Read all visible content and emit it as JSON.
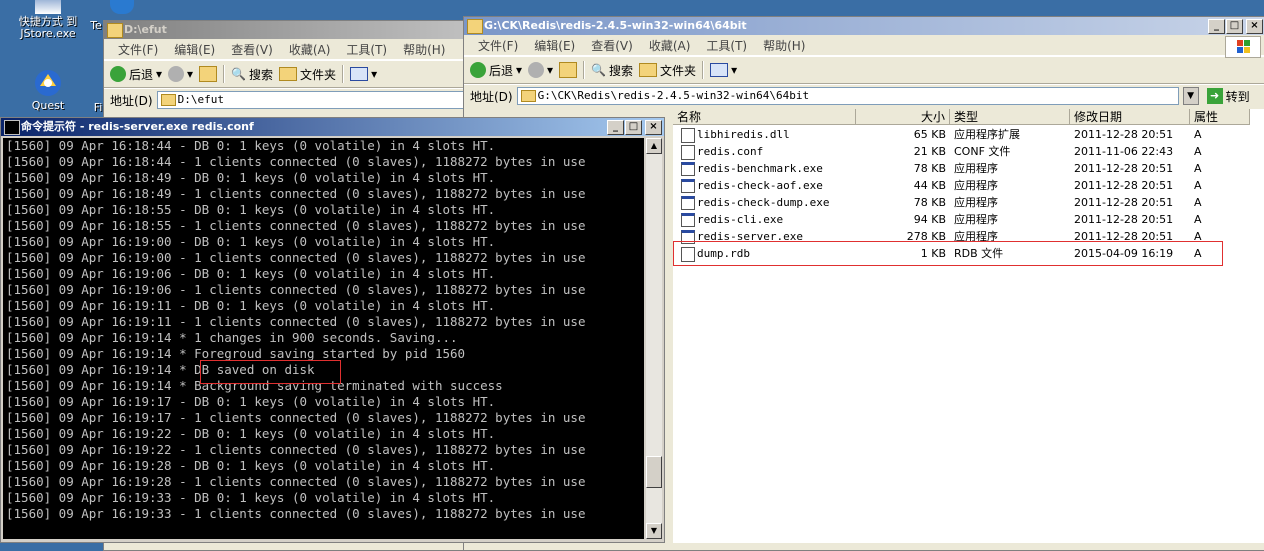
{
  "desktop": {
    "icon1_label": "快捷方式 到",
    "icon1_sublabel": "JStore.exe",
    "icon2_label": "Quest",
    "icon3_label": "Te",
    "icon4_label": "Fi"
  },
  "explorer_back": {
    "title": "D:\\efut",
    "menu": [
      "文件(F)",
      "编辑(E)",
      "查看(V)",
      "收藏(A)",
      "工具(T)",
      "帮助(H)"
    ],
    "back_label": "后退",
    "search_label": "搜索",
    "folders_label": "文件夹",
    "address_label": "地址(D)",
    "address_value": "D:\\efut"
  },
  "explorer_front": {
    "title": "G:\\CK\\Redis\\redis-2.4.5-win32-win64\\64bit",
    "menu": [
      "文件(F)",
      "编辑(E)",
      "查看(V)",
      "收藏(A)",
      "工具(T)",
      "帮助(H)"
    ],
    "back_label": "后退",
    "search_label": "搜索",
    "folders_label": "文件夹",
    "address_label": "地址(D)",
    "address_value": "G:\\CK\\Redis\\redis-2.4.5-win32-win64\\64bit",
    "go_label": "转到",
    "columns": {
      "name": "名称",
      "size": "大小",
      "type": "类型",
      "modified": "修改日期",
      "attr": "属性"
    },
    "files": [
      {
        "name": "libhiredis.dll",
        "size": "65 KB",
        "type": "应用程序扩展",
        "modified": "2011-12-28 20:51",
        "attr": "A",
        "icon": "dll-icon"
      },
      {
        "name": "redis.conf",
        "size": "21 KB",
        "type": "CONF 文件",
        "modified": "2011-11-06 22:43",
        "attr": "A",
        "icon": "file-icon"
      },
      {
        "name": "redis-benchmark.exe",
        "size": "78 KB",
        "type": "应用程序",
        "modified": "2011-12-28 20:51",
        "attr": "A",
        "icon": "exe-icon"
      },
      {
        "name": "redis-check-aof.exe",
        "size": "44 KB",
        "type": "应用程序",
        "modified": "2011-12-28 20:51",
        "attr": "A",
        "icon": "exe-icon"
      },
      {
        "name": "redis-check-dump.exe",
        "size": "78 KB",
        "type": "应用程序",
        "modified": "2011-12-28 20:51",
        "attr": "A",
        "icon": "exe-icon"
      },
      {
        "name": "redis-cli.exe",
        "size": "94 KB",
        "type": "应用程序",
        "modified": "2011-12-28 20:51",
        "attr": "A",
        "icon": "exe-icon"
      },
      {
        "name": "redis-server.exe",
        "size": "278 KB",
        "type": "应用程序",
        "modified": "2011-12-28 20:51",
        "attr": "A",
        "icon": "exe-icon"
      },
      {
        "name": "dump.rdb",
        "size": "1 KB",
        "type": "RDB 文件",
        "modified": "2015-04-09 16:19",
        "attr": "A",
        "icon": "file-icon"
      }
    ]
  },
  "console": {
    "title": "命令提示符 - redis-server.exe redis.conf",
    "lines": [
      "[1560] 09 Apr 16:18:44 - DB 0: 1 keys (0 volatile) in 4 slots HT.",
      "[1560] 09 Apr 16:18:44 - 1 clients connected (0 slaves), 1188272 bytes in use",
      "[1560] 09 Apr 16:18:49 - DB 0: 1 keys (0 volatile) in 4 slots HT.",
      "[1560] 09 Apr 16:18:49 - 1 clients connected (0 slaves), 1188272 bytes in use",
      "[1560] 09 Apr 16:18:55 - DB 0: 1 keys (0 volatile) in 4 slots HT.",
      "[1560] 09 Apr 16:18:55 - 1 clients connected (0 slaves), 1188272 bytes in use",
      "[1560] 09 Apr 16:19:00 - DB 0: 1 keys (0 volatile) in 4 slots HT.",
      "[1560] 09 Apr 16:19:00 - 1 clients connected (0 slaves), 1188272 bytes in use",
      "[1560] 09 Apr 16:19:06 - DB 0: 1 keys (0 volatile) in 4 slots HT.",
      "[1560] 09 Apr 16:19:06 - 1 clients connected (0 slaves), 1188272 bytes in use",
      "[1560] 09 Apr 16:19:11 - DB 0: 1 keys (0 volatile) in 4 slots HT.",
      "[1560] 09 Apr 16:19:11 - 1 clients connected (0 slaves), 1188272 bytes in use",
      "[1560] 09 Apr 16:19:14 * 1 changes in 900 seconds. Saving...",
      "[1560] 09 Apr 16:19:14 * Foregroud saving started by pid 1560",
      "[1560] 09 Apr 16:19:14 * DB saved on disk",
      "[1560] 09 Apr 16:19:14 * Background saving terminated with success",
      "[1560] 09 Apr 16:19:17 - DB 0: 1 keys (0 volatile) in 4 slots HT.",
      "[1560] 09 Apr 16:19:17 - 1 clients connected (0 slaves), 1188272 bytes in use",
      "[1560] 09 Apr 16:19:22 - DB 0: 1 keys (0 volatile) in 4 slots HT.",
      "[1560] 09 Apr 16:19:22 - 1 clients connected (0 slaves), 1188272 bytes in use",
      "[1560] 09 Apr 16:19:28 - DB 0: 1 keys (0 volatile) in 4 slots HT.",
      "[1560] 09 Apr 16:19:28 - 1 clients connected (0 slaves), 1188272 bytes in use",
      "[1560] 09 Apr 16:19:33 - DB 0: 1 keys (0 volatile) in 4 slots HT.",
      "[1560] 09 Apr 16:19:33 - 1 clients connected (0 slaves), 1188272 bytes in use"
    ]
  },
  "colors": {
    "active_title": "#0a246a",
    "highlight": "#e03030",
    "console_bg": "#000000",
    "console_text": "#c0c0c0"
  }
}
